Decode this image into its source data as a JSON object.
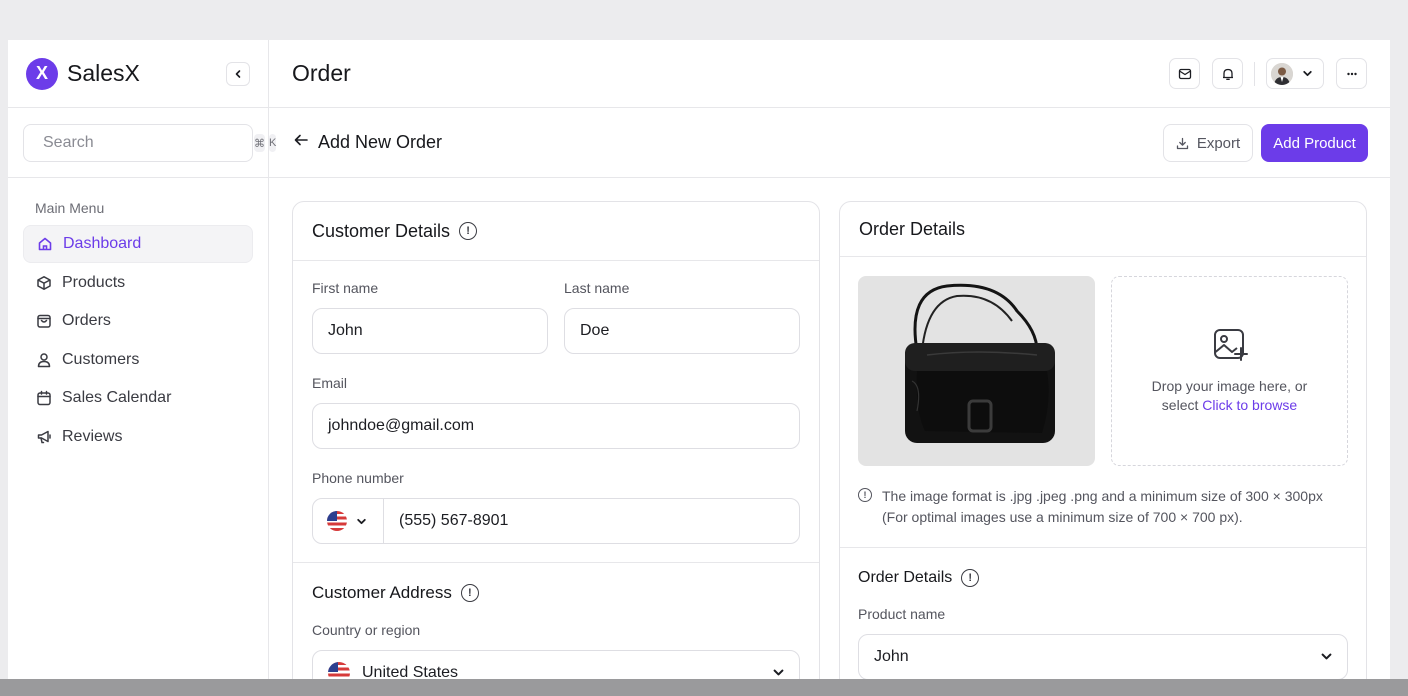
{
  "brand": {
    "logo_letter": "X",
    "name": "SalesX"
  },
  "search": {
    "placeholder": "Search",
    "shortcut_cmd": "⌘",
    "shortcut_key": "K"
  },
  "menu": {
    "title": "Main Menu",
    "items": [
      {
        "label": "Dashboard",
        "icon": "home-icon",
        "active": true
      },
      {
        "label": "Products",
        "icon": "box-icon"
      },
      {
        "label": "Orders",
        "icon": "bag-icon"
      },
      {
        "label": "Customers",
        "icon": "user-icon"
      },
      {
        "label": "Sales Calendar",
        "icon": "calendar-icon"
      },
      {
        "label": "Reviews",
        "icon": "megaphone-icon"
      }
    ]
  },
  "header": {
    "title": "Order"
  },
  "subheader": {
    "title": "Add New Order",
    "export_label": "Export",
    "add_product_label": "Add Product"
  },
  "customer": {
    "title": "Customer Details",
    "first_name_label": "First name",
    "first_name_value": "John",
    "last_name_label": "Last name",
    "last_name_value": "Doe",
    "email_label": "Email",
    "email_value": "johndoe@gmail.com",
    "phone_label": "Phone number",
    "phone_value": "(555) 567-8901"
  },
  "address": {
    "title": "Customer Address",
    "country_label": "Country or region",
    "country_value": "United States"
  },
  "order": {
    "title": "Order Details",
    "drop_text": "Drop your image here, or",
    "drop_select": "select",
    "drop_link": "Click to browse",
    "note_line1": "The image format is .jpg .jpeg .png and a minimum size of 300 × 300px",
    "note_line2": "(For optimal images use a minimum size of 700 × 700 px).",
    "section_title": "Order Details",
    "product_name_label": "Product name",
    "product_name_value": "John"
  },
  "colors": {
    "accent": "#6c3ce9"
  }
}
